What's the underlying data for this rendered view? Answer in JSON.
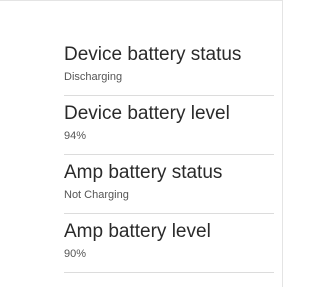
{
  "settings": {
    "items": [
      {
        "title": "Device battery status",
        "summary": "Discharging"
      },
      {
        "title": "Device battery level",
        "summary": "94%"
      },
      {
        "title": "Amp battery status",
        "summary": "Not Charging"
      },
      {
        "title": "Amp battery level",
        "summary": "90%"
      }
    ]
  }
}
